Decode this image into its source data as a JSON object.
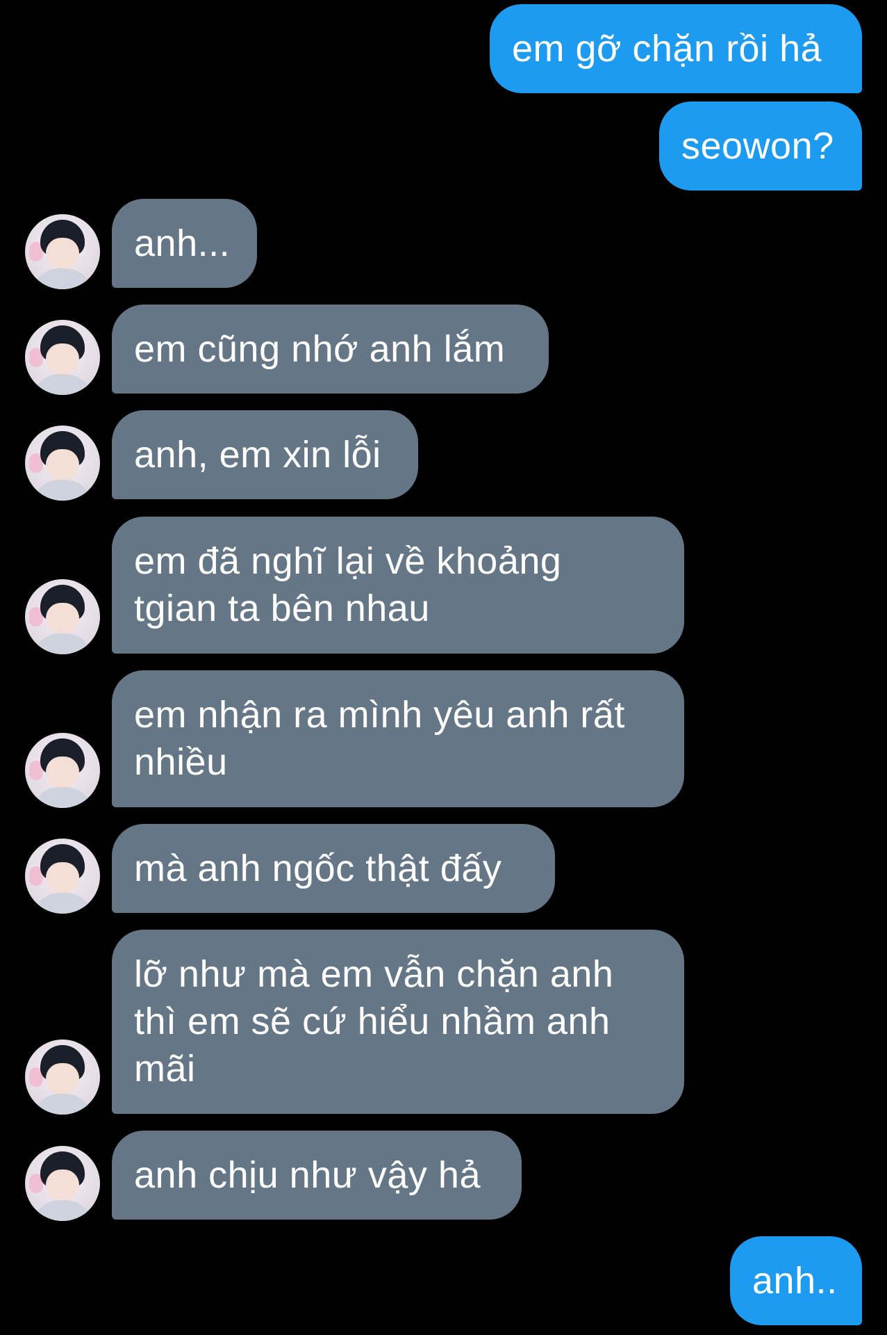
{
  "conversation": {
    "messages": [
      {
        "side": "sent",
        "text": "em gỡ chặn rồi hả"
      },
      {
        "side": "sent",
        "text": "seowon?"
      },
      {
        "side": "received",
        "text": "anh..."
      },
      {
        "side": "received",
        "text": "em cũng nhớ anh lắm"
      },
      {
        "side": "received",
        "text": "anh, em xin lỗi"
      },
      {
        "side": "received",
        "text": "em đã nghĩ lại về khoảng\ntgian ta bên nhau"
      },
      {
        "side": "received",
        "text": "em nhận ra mình yêu anh rất\nnhiều"
      },
      {
        "side": "received",
        "text": "mà anh ngốc thật đấy"
      },
      {
        "side": "received",
        "text": "lỡ như mà em vẫn chặn anh\nthì em sẽ cứ hiểu nhầm anh\nmãi"
      },
      {
        "side": "received",
        "text": "anh chịu như vậy hả"
      },
      {
        "side": "sent",
        "text": "anh.."
      }
    ]
  },
  "colors": {
    "background": "#000000",
    "sent_bubble": "#1d9bf0",
    "received_bubble": "#657786",
    "text": "#ffffff"
  },
  "icons": {
    "avatar": "contact-avatar-photo"
  }
}
